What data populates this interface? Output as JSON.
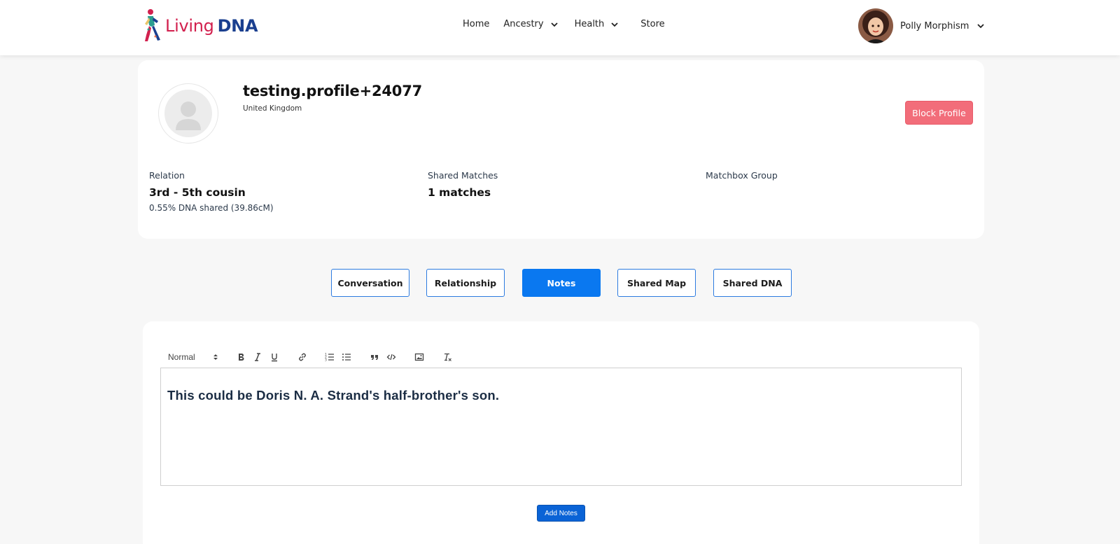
{
  "brand": {
    "word_living": "Living",
    "word_dna": "DNA",
    "colors": {
      "living": "#d2204e",
      "dna": "#1a3f8f"
    }
  },
  "nav": {
    "items": [
      {
        "label": "Home",
        "icon": null
      },
      {
        "label": "Ancestry",
        "icon": "chevron-down-icon"
      },
      {
        "label": "Health",
        "icon": "chevron-down-icon"
      },
      {
        "label": "Store",
        "icon": null
      }
    ]
  },
  "user": {
    "name": "Polly Morphism",
    "icon": "chevron-down-icon"
  },
  "profile": {
    "name": "testing.profile+24077",
    "country": "United Kingdom",
    "block_label": "Block Profile",
    "block_color": "#f26d7a",
    "stats": [
      {
        "label": "Relation",
        "value": "3rd - 5th cousin",
        "sub": "0.55% DNA shared (39.86cM)"
      },
      {
        "label": "Shared Matches",
        "value": "1 matches",
        "sub": ""
      },
      {
        "label": "Matchbox Group",
        "value": "",
        "sub": ""
      }
    ]
  },
  "tabs": [
    {
      "label": "Conversation",
      "active": false
    },
    {
      "label": "Relationship",
      "active": false
    },
    {
      "label": "Notes",
      "active": true
    },
    {
      "label": "Shared Map",
      "active": false
    },
    {
      "label": "Shared DNA",
      "active": false
    }
  ],
  "accent_color": "#0a78f0",
  "editor": {
    "format_select": "Normal",
    "toolbar_icons": [
      "bold-icon",
      "italic-icon",
      "underline-icon",
      "link-icon",
      "ordered-list-icon",
      "bullet-list-icon",
      "blockquote-icon",
      "code-icon",
      "image-icon",
      "clear-format-icon"
    ],
    "content": "This could be Doris N. A. Strand's half-brother's son.",
    "submit_label": "Add Notes"
  }
}
